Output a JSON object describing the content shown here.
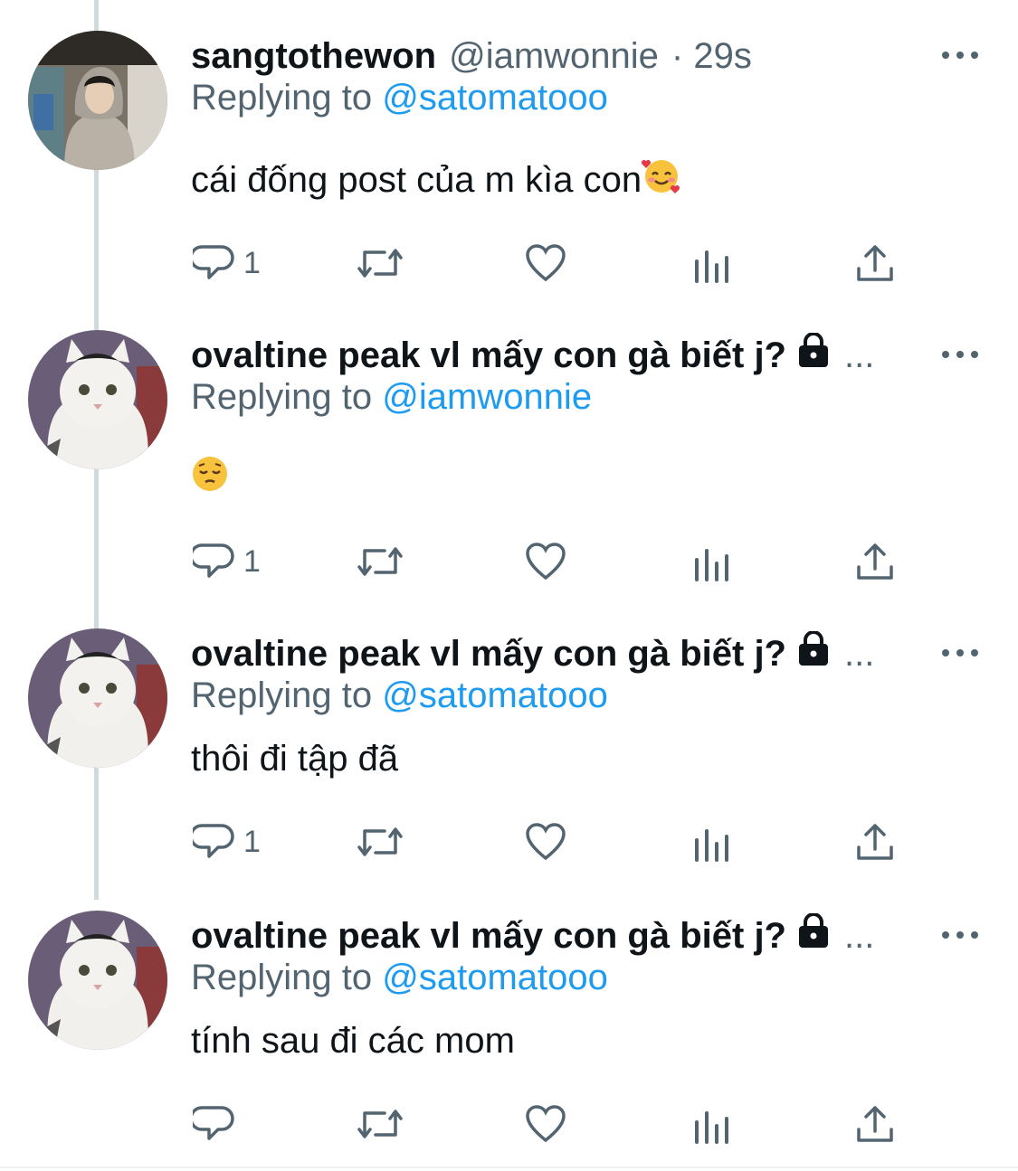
{
  "tweets": [
    {
      "name": "sangtothewon",
      "handle": "@iamwonnie",
      "time": "· 29s",
      "replying_prefix": "Replying to",
      "replying_to": "@satomatooo",
      "text": "cái đống post của m kìa con",
      "emoji": "smiling-face-with-hearts",
      "reply_count": "1",
      "avatar": "person-in-hoodie"
    },
    {
      "name": "ovaltine peak vl mấy con gà biết j?",
      "locked": true,
      "trunc": "...",
      "replying_prefix": "Replying to",
      "replying_to": "@iamwonnie",
      "text": "",
      "emoji": "pensive-face",
      "reply_count": "1",
      "avatar": "white-cat"
    },
    {
      "name": "ovaltine peak vl mấy con gà biết j?",
      "locked": true,
      "trunc": "...",
      "replying_prefix": "Replying to",
      "replying_to": "@satomatooo",
      "text": "thôi đi tập đã",
      "reply_count": "1",
      "avatar": "white-cat"
    },
    {
      "name": "ovaltine peak vl mấy con gà biết j?",
      "locked": true,
      "trunc": "...",
      "replying_prefix": "Replying to",
      "replying_to": "@satomatooo",
      "text": "tính sau đi các mom",
      "reply_count": "",
      "avatar": "white-cat"
    }
  ],
  "colors": {
    "text": "#0f1419",
    "secondary": "#536471",
    "mention": "#1d9bf0",
    "thread_line": "#cfd9de"
  }
}
